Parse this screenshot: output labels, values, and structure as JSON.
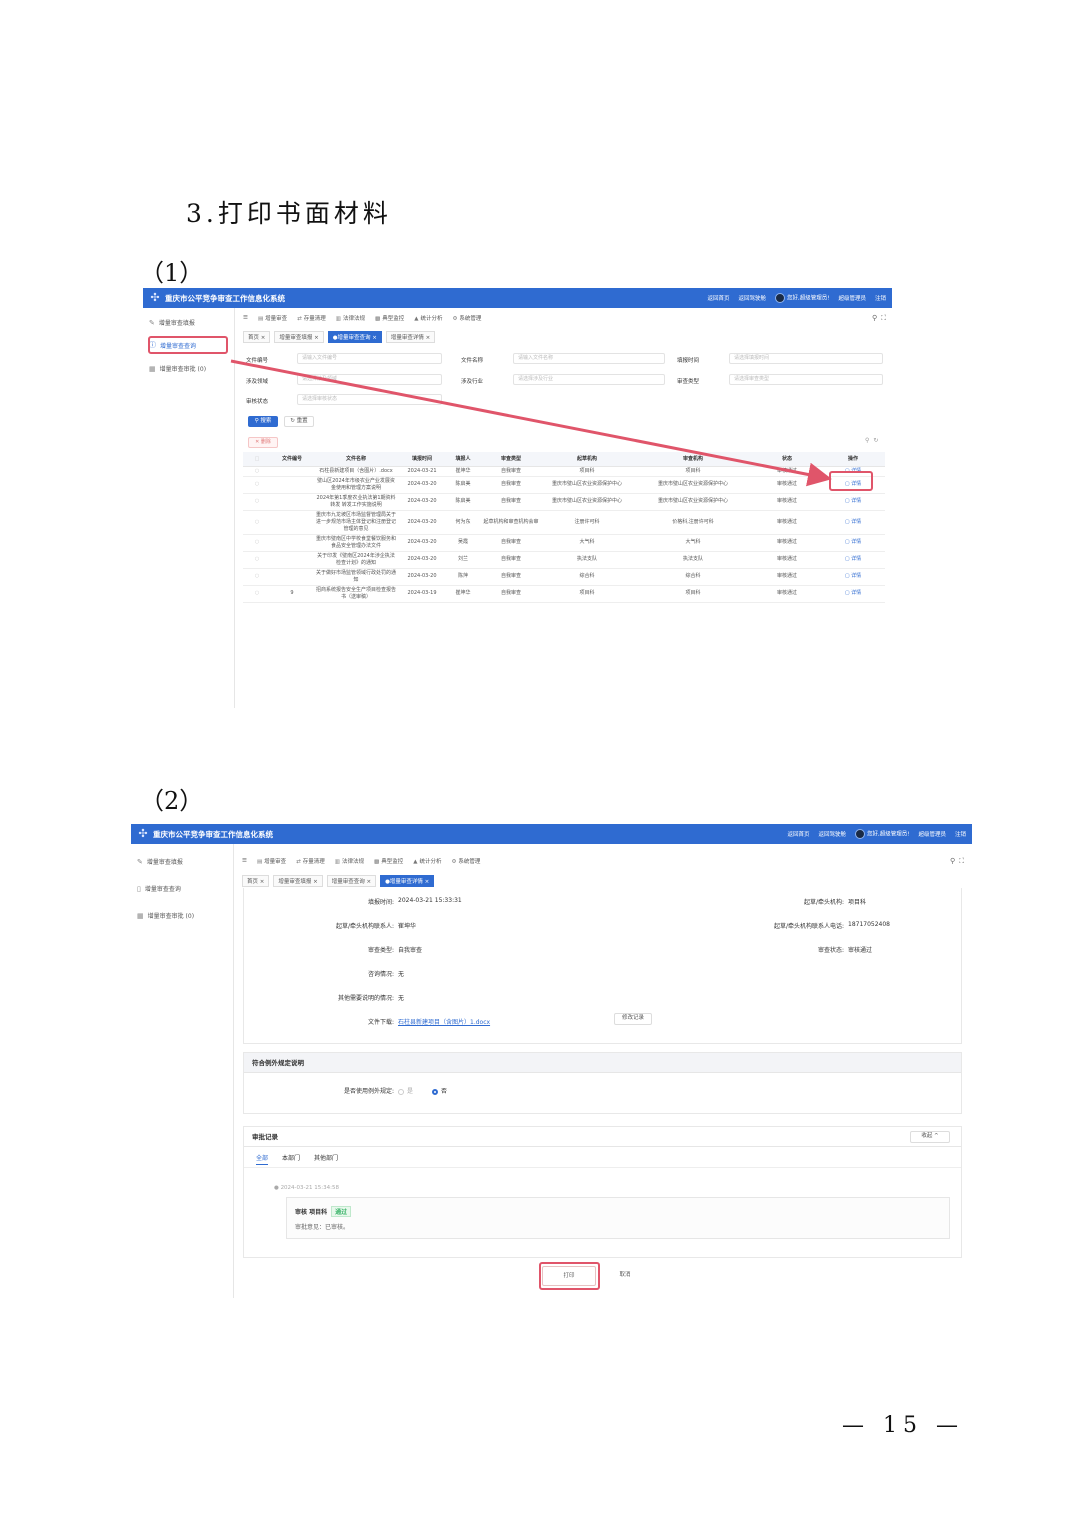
{
  "doc": {
    "heading": "3.打印书面材料",
    "step1": "（1）",
    "step2": "（2）",
    "page_number": "— 15 —"
  },
  "system": {
    "title": "重庆市公平竞争审查工作信息化系统",
    "top_links": [
      "返回首页",
      "返回驾驶舱",
      "您好,超级管理员!",
      "超级管理员",
      "注销"
    ]
  },
  "sidebar": {
    "items": [
      "增量审查填报",
      "增量审查查询",
      "增量审查审批 (0)"
    ]
  },
  "menu": {
    "items": [
      "增量审查",
      "存量清理",
      "法律法规",
      "典型监控",
      "统计分析",
      "系统管理"
    ]
  },
  "shot1": {
    "tabs": [
      "首页 ×",
      "增量审查填报 ×",
      "●增量审查查询 ×",
      "增量审查详情 ×"
    ],
    "filters": {
      "doc_no_label": "文件编号",
      "doc_no_placeholder": "请输入文件编号",
      "doc_name_label": "文件名称",
      "doc_name_placeholder": "请输入文件名称",
      "report_time_label": "填报时间",
      "report_time_placeholder": "请选择填报时间",
      "scope_label": "涉及领域",
      "scope_placeholder": "请选择涉及领域",
      "industry_label": "涉及行业",
      "industry_placeholder": "请选择涉及行业",
      "review_type_label": "审查类型",
      "review_type_placeholder": "请选择审查类型",
      "status_label": "审核状态",
      "status_placeholder": "请选择审核状态",
      "search_btn": "搜索",
      "reset_btn": "重置",
      "delete_btn": "删除"
    },
    "table": {
      "columns": [
        "",
        "文件编号",
        "文件名称",
        "填报时间",
        "填报人",
        "审查类型",
        "起草机构",
        "审查机构",
        "状态",
        "操作"
      ],
      "rows": [
        [
          "",
          "",
          "石柱县新建项目（含图片）.docx",
          "2024-03-21",
          "崔坤华",
          "自我审查",
          "项目科",
          "项目科",
          "审核通过",
          "详情"
        ],
        [
          "",
          "",
          "璧山区2024年市级农业产业发展资金使用和管理方案说明",
          "2024-03-20",
          "陈启美",
          "自我审查",
          "重庆市璧山区农业资源保护中心",
          "重庆市璧山区农业资源保护中心",
          "审核通过",
          "详情"
        ],
        [
          "",
          "",
          "2024年第1季度农业执法第1期资料转发 转发工作实施说明",
          "2024-03-20",
          "陈启美",
          "自我审查",
          "重庆市璧山区农业资源保护中心",
          "重庆市璧山区农业资源保护中心",
          "审核通过",
          "详情"
        ],
        [
          "",
          "",
          "重庆市九龙坡区市场监督管理局关于进一步规范市场主体登记和注册登记管理的意见",
          "2024-03-20",
          "何为东",
          "起草机构和审查机构会审",
          "注册许可科",
          "价格科,注册许可科",
          "审核通过",
          "详情"
        ],
        [
          "",
          "",
          "重庆市璧南区中学校食堂餐饮服务和食品安全管理办法文件",
          "2024-03-20",
          "吴霞",
          "自我审查",
          "大气科",
          "大气科",
          "审核通过",
          "详情"
        ],
        [
          "",
          "",
          "关于印发《璧南区2024年涉企执法检查计划》的通知",
          "2024-03-20",
          "刘兰",
          "自我审查",
          "执法支队",
          "执法支队",
          "审核通过",
          "详情"
        ],
        [
          "",
          "",
          "关于做好市场监管领域行政处罚的通知",
          "2024-03-20",
          "陈萍",
          "自我审查",
          "综合科",
          "综合科",
          "审核通过",
          "详情"
        ],
        [
          "",
          "9",
          "招商系统报告安全生产项目检查报告书（送审稿）",
          "2024-03-19",
          "崔坤华",
          "自我审查",
          "项目科",
          "项目科",
          "审核通过",
          "详情"
        ]
      ]
    }
  },
  "shot2": {
    "tabs": [
      "首页 ×",
      "增量审查填报 ×",
      "增量审查查询 ×",
      "●增量审查详情 ×"
    ],
    "detail": {
      "report_time_label": "填报时间:",
      "report_time": "2024-03-21 15:33:31",
      "drafter_org_label": "起草/牵头机构:",
      "drafter_org": "项目科",
      "contact_label": "起草/牵头机构联系人:",
      "contact": "崔坤华",
      "contact_phone_label": "起草/牵头机构联系人电话:",
      "contact_phone": "18717052408",
      "review_type_label": "审查类型:",
      "review_type": "自我审查",
      "review_status_label": "审查状态:",
      "review_status": "审核通过",
      "opinion_label": "咨询情况:",
      "opinion": "无",
      "other_label": "其他需要说明的情况:",
      "other": "无",
      "file_label": "文件下载:",
      "file_name": "石柱县新建项目（含图片）1.docx",
      "history_btn": "修改记录"
    },
    "exception": {
      "title": "符合例外规定说明",
      "question": "是否使用例外规定:",
      "options": [
        "是",
        "否"
      ],
      "selected": "否"
    },
    "approval": {
      "title": "审批记录",
      "collapse_btn": "收起 ^",
      "tabs": [
        "全部",
        "本部门",
        "其他部门"
      ],
      "time": "2024-03-21 15:34:58",
      "reviewer": "审核 项目科",
      "result": "通过",
      "comment": "审批意见：已审核。"
    },
    "print_btn": "打印",
    "cancel_btn": "取消"
  },
  "colors": {
    "brand": "#2f6bd1",
    "highlight": "#e0556a"
  }
}
